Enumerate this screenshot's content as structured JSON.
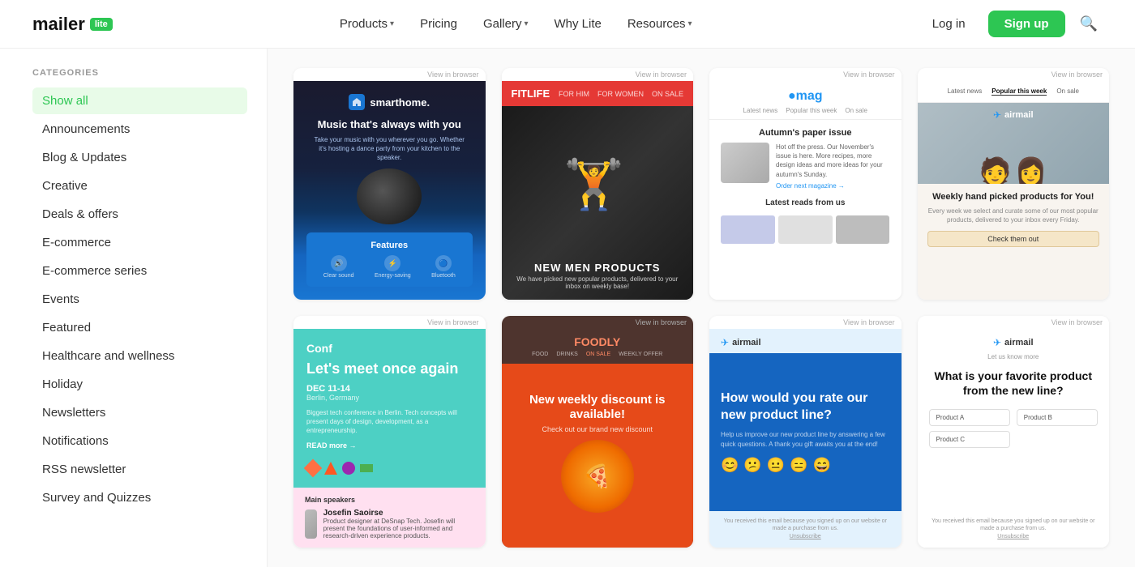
{
  "header": {
    "logo_text": "mailer",
    "logo_badge": "lite",
    "nav": [
      {
        "label": "Products",
        "has_arrow": true
      },
      {
        "label": "Pricing",
        "has_arrow": false
      },
      {
        "label": "Gallery",
        "has_arrow": true
      },
      {
        "label": "Why Lite",
        "has_arrow": false
      },
      {
        "label": "Resources",
        "has_arrow": true
      }
    ],
    "login_label": "Log in",
    "signup_label": "Sign up"
  },
  "sidebar": {
    "categories_label": "CATEGORIES",
    "items": [
      {
        "label": "Show all",
        "active": true
      },
      {
        "label": "Announcements",
        "active": false
      },
      {
        "label": "Blog & Updates",
        "active": false
      },
      {
        "label": "Creative",
        "active": false
      },
      {
        "label": "Deals & offers",
        "active": false
      },
      {
        "label": "E-commerce",
        "active": false
      },
      {
        "label": "E-commerce series",
        "active": false
      },
      {
        "label": "Events",
        "active": false
      },
      {
        "label": "Featured",
        "active": false
      },
      {
        "label": "Healthcare and wellness",
        "active": false
      },
      {
        "label": "Holiday",
        "active": false
      },
      {
        "label": "Newsletters",
        "active": false
      },
      {
        "label": "Notifications",
        "active": false
      },
      {
        "label": "RSS newsletter",
        "active": false
      },
      {
        "label": "Survey and Quizzes",
        "active": false
      }
    ]
  },
  "templates": {
    "view_in_browser": "View in browser",
    "cards": [
      {
        "id": "smarthome",
        "brand": "smarthome.",
        "headline": "Music that's always with you",
        "sub": "Take your music with you wherever you go. Whether it's hosting a dance party from your kitchen to the speaker.",
        "features_title": "Features",
        "features": [
          {
            "icon": "🔊",
            "label": "Clear sound"
          },
          {
            "icon": "⚡",
            "label": "Energy-saving"
          },
          {
            "icon": "🔵",
            "label": "Bluetooth"
          }
        ]
      },
      {
        "id": "fitlife",
        "brand": "FITLIFE",
        "nav_items": [
          "FOR HIM",
          "FOR WOMEN",
          "ON SALE"
        ],
        "title": "NEW MEN PRODUCTS",
        "desc": "We have picked new popular products, delivered to your inbox on weekly base!"
      },
      {
        "id": "mag",
        "brand": "●mag",
        "nav_items": [
          "Latest news",
          "Popular this week",
          "On sale"
        ],
        "issue_title": "Autumn's paper issue",
        "issue_desc": "Hot off the press. Our November's issue is here. More recipes, more design ideas and more ideas for your autumn's Sunday.",
        "cta": "Order next magazine →",
        "latest": "Latest reads from us"
      },
      {
        "id": "airmail",
        "brand": "airmail",
        "nav_items": [
          "Latest news",
          "Popular this week",
          "On sale"
        ],
        "headline": "Weekly hand picked products for You!",
        "desc": "Every week we select and curate some of our most popular products, delivered to your inbox every Friday.",
        "cta": "Check them out"
      },
      {
        "id": "conference",
        "brand": "Conf",
        "headline": "Let's meet once again",
        "date": "DEC 11-14",
        "location": "Berlin, Germany",
        "desc": "Biggest tech conference in Berlin. Tech concepts will present days of design, development, as a entrepreneurship.",
        "link": "READ more →",
        "speakers_title": "Main speakers",
        "speaker_name": "Josefin Saoirse",
        "speaker_desc": "Product designer at DeSnap Tech. Josefin will present the foundations of user-informed and research-driven experience products."
      },
      {
        "id": "foodly",
        "brand": "FOODLY",
        "nav_items": [
          "FOOD",
          "DRINKS",
          "ON SALE",
          "WEEKLY OFFER"
        ],
        "promo_title": "New weekly discount is available!",
        "promo_sub": "Check out our brand new discount"
      },
      {
        "id": "survey-rate",
        "brand": "airmail",
        "question": "How would you rate our new product line?",
        "desc": "Help us improve our new product line by answering a few quick questions. A thank you gift awaits you at the end!",
        "emojis": [
          "😊",
          "😕",
          "😐",
          "😑",
          "😄"
        ],
        "footer": "You received this email because you signed up on our website or made a purchase from us.",
        "unsubscribe": "Unsubscribe"
      },
      {
        "id": "survey-quiz",
        "brand": "airmail",
        "intro": "Let us know more",
        "question": "What is your favorite product from the new line?",
        "options": [
          {
            "label": "Product A"
          },
          {
            "label": "Product B"
          },
          {
            "label": "Product C"
          }
        ],
        "footer": "You received this email because you signed up on our website or made a purchase from us.",
        "unsubscribe": "Unsubscribe"
      }
    ]
  }
}
